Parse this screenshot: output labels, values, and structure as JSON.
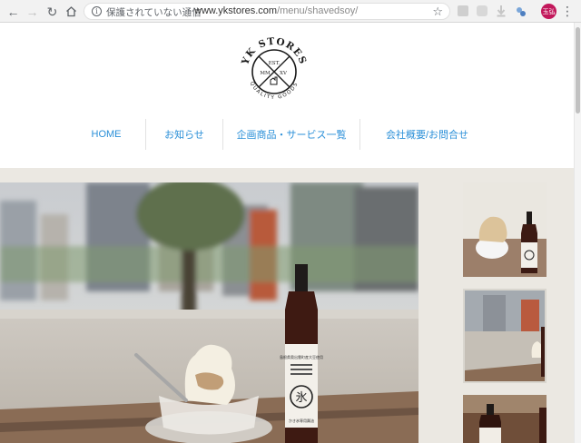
{
  "browser": {
    "security_label": "保護されていない通信",
    "url_host": "www.ykstores.com",
    "url_path": "/menu/shavedsoy/",
    "profile_label": "玉弘"
  },
  "logo": {
    "brand": "YK STORES",
    "tagline": "QUALITY GOODS",
    "est": "EST.",
    "year_left": "MM",
    "year_right": "XV"
  },
  "nav": {
    "items": [
      {
        "label": "HOME"
      },
      {
        "label": "お知らせ"
      },
      {
        "label": "企画商品・サービス一覧"
      },
      {
        "label": "会社概要/お問合せ"
      }
    ]
  },
  "product": {
    "bottle_label_char": "氷",
    "bottle_label_text": "かき氷専用醤油",
    "bottle_top_text": "島根県奥出雲町産大豆使用"
  },
  "colors": {
    "nav_link": "#2a8fd8",
    "content_bg": "#ebe8e2"
  }
}
